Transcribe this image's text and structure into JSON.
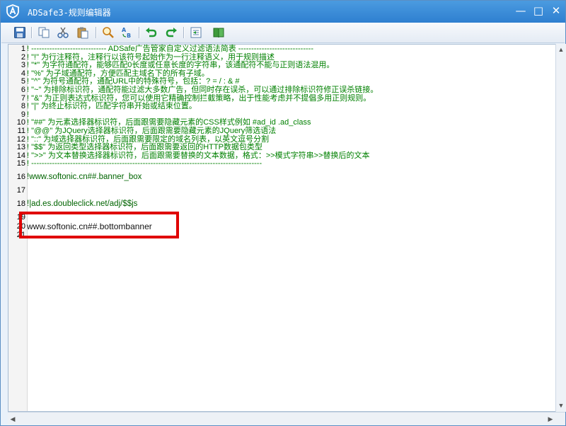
{
  "window": {
    "title": "ADSafe3-规则编辑器",
    "controls": {
      "minimize": "—",
      "maximize": "□",
      "close": "✕"
    }
  },
  "toolbar": {
    "buttons": [
      "save-icon",
      "copy-icon",
      "cut-icon",
      "paste-icon",
      "find-icon",
      "replace-icon",
      "undo-icon",
      "redo-icon",
      "indent-icon",
      "book-icon"
    ]
  },
  "editor": {
    "lines": [
      {
        "n": "1",
        "t": "! ----------------------------- ADSafe广告管家自定义过滤语法简表 -----------------------------"
      },
      {
        "n": "2",
        "t": "! \"!\" 为行注释符，注释行以该符号起始作为一行注释语义，用于规则描述"
      },
      {
        "n": "3",
        "t": "! \"*\" 为字符通配符，能够匹配0长度或任意长度的字符串，该通配符不能与正则语法混用。"
      },
      {
        "n": "4",
        "t": "! \"%\" 为子域通配符，方便匹配主域名下的所有子域。"
      },
      {
        "n": "5",
        "t": "! \"^\" 为符号通配符，通配URL中的特殊符号，包括：? = / : & #"
      },
      {
        "n": "6",
        "t": "! \"~\" 为排除标识符，通配符能过滤大多数广告，但同时存在误杀，可以通过排除标识符修正误杀链接。"
      },
      {
        "n": "7",
        "t": "! \"&\" 为正则表达式标识符，您可以使用它精确控制拦截策略，出于性能考虑并不提倡多用正则规则。"
      },
      {
        "n": "8",
        "t": "! \"|\" 为终止标识符，匹配字符串开始或结束位置。"
      },
      {
        "n": "9",
        "t": "!"
      },
      {
        "n": "10",
        "t": "! \"##\" 为元素选择器标识符，后面跟需要隐藏元素的CSS样式例如 #ad_id  .ad_class"
      },
      {
        "n": "11",
        "t": "! \"@@\" 为JQuery选择器标识符，后面跟需要隐藏元素的JQuery筛选语法"
      },
      {
        "n": "12",
        "t": "! \"::\" 为域选择器标识符，后面跟需要限定的域名列表，以英文逗号分割"
      },
      {
        "n": "13",
        "t": "! \"$$\" 为返回类型选择器标识符，后面跟需要返回的HTTP数据包类型"
      },
      {
        "n": "14",
        "t": "! \">>\" 为文本替换选择器标识符，后面跟需要替换的文本数据，格式：>>模式字符串>>替换后的文本"
      },
      {
        "n": "15",
        "t": "! -----------------------------------------------------------------------------------------"
      },
      {
        "n": "16",
        "t": "!www.softonic.cn##.banner_box"
      },
      {
        "n": "17",
        "t": ""
      },
      {
        "n": "18",
        "t": "!|ad.es.doubleclick.net/adj/$$js"
      },
      {
        "n": "19",
        "t": ""
      },
      {
        "n": "20",
        "t": "www.softonic.cn##.bottombanner"
      },
      {
        "n": "21",
        "t": ""
      }
    ]
  }
}
